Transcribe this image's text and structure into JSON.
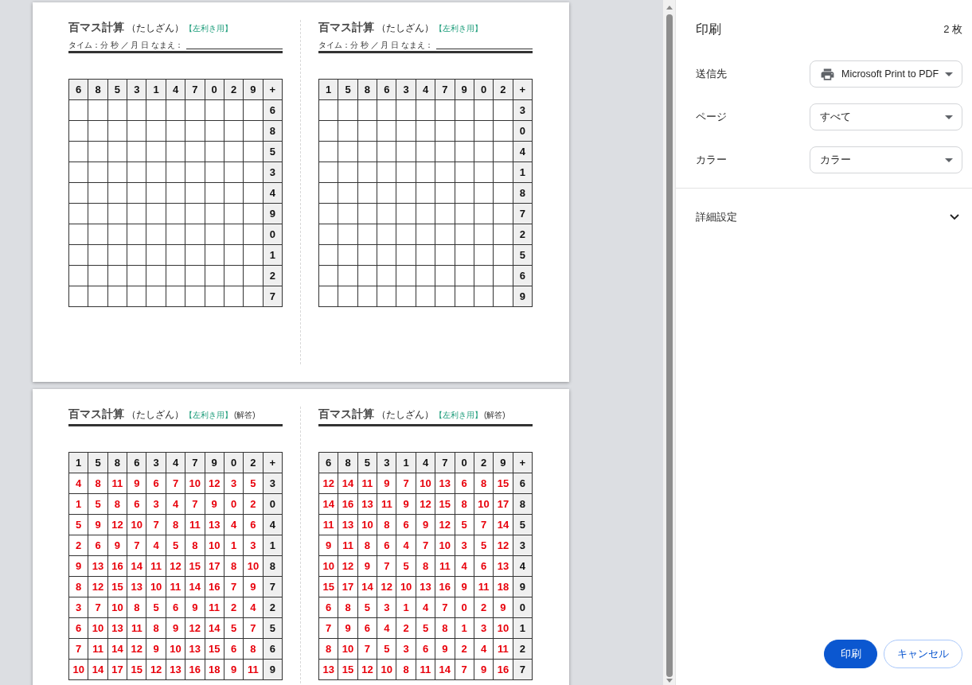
{
  "preview": {
    "pages": [
      {
        "sheets": [
          {
            "kind": "problem",
            "title": "百マス計算",
            "subtitle": "（たしざん）",
            "tag": "【左利き用】",
            "info_line": "タイム：分 秒 ／ 月 日 なまえ：",
            "grid": {
              "header": [
                "6",
                "8",
                "5",
                "3",
                "1",
                "4",
                "7",
                "0",
                "2",
                "9"
              ],
              "corner": "+",
              "rows": [
                {
                  "addend": "6"
                },
                {
                  "addend": "8"
                },
                {
                  "addend": "5"
                },
                {
                  "addend": "3"
                },
                {
                  "addend": "4"
                },
                {
                  "addend": "9"
                },
                {
                  "addend": "0"
                },
                {
                  "addend": "1"
                },
                {
                  "addend": "2"
                },
                {
                  "addend": "7"
                }
              ]
            }
          },
          {
            "kind": "problem",
            "title": "百マス計算",
            "subtitle": "（たしざん）",
            "tag": "【左利き用】",
            "info_line": "タイム：分 秒 ／ 月 日 なまえ：",
            "grid": {
              "header": [
                "1",
                "5",
                "8",
                "6",
                "3",
                "4",
                "7",
                "9",
                "0",
                "2"
              ],
              "corner": "+",
              "rows": [
                {
                  "addend": "3"
                },
                {
                  "addend": "0"
                },
                {
                  "addend": "4"
                },
                {
                  "addend": "1"
                },
                {
                  "addend": "8"
                },
                {
                  "addend": "7"
                },
                {
                  "addend": "2"
                },
                {
                  "addend": "5"
                },
                {
                  "addend": "6"
                },
                {
                  "addend": "9"
                }
              ]
            }
          }
        ]
      },
      {
        "sheets": [
          {
            "kind": "answer",
            "title": "百マス計算",
            "subtitle": "（たしざん）",
            "tag": "【左利き用】",
            "answer_label": "(解答)",
            "grid": {
              "header": [
                "1",
                "5",
                "8",
                "6",
                "3",
                "4",
                "7",
                "9",
                "0",
                "2"
              ],
              "corner": "+",
              "rows": [
                {
                  "cells": [
                    "4",
                    "8",
                    "11",
                    "9",
                    "6",
                    "7",
                    "10",
                    "12",
                    "3",
                    "5"
                  ],
                  "addend": "3"
                },
                {
                  "cells": [
                    "1",
                    "5",
                    "8",
                    "6",
                    "3",
                    "4",
                    "7",
                    "9",
                    "0",
                    "2"
                  ],
                  "addend": "0"
                },
                {
                  "cells": [
                    "5",
                    "9",
                    "12",
                    "10",
                    "7",
                    "8",
                    "11",
                    "13",
                    "4",
                    "6"
                  ],
                  "addend": "4"
                },
                {
                  "cells": [
                    "2",
                    "6",
                    "9",
                    "7",
                    "4",
                    "5",
                    "8",
                    "10",
                    "1",
                    "3"
                  ],
                  "addend": "1"
                },
                {
                  "cells": [
                    "9",
                    "13",
                    "16",
                    "14",
                    "11",
                    "12",
                    "15",
                    "17",
                    "8",
                    "10"
                  ],
                  "addend": "8"
                },
                {
                  "cells": [
                    "8",
                    "12",
                    "15",
                    "13",
                    "10",
                    "11",
                    "14",
                    "16",
                    "7",
                    "9"
                  ],
                  "addend": "7"
                },
                {
                  "cells": [
                    "3",
                    "7",
                    "10",
                    "8",
                    "5",
                    "6",
                    "9",
                    "11",
                    "2",
                    "4"
                  ],
                  "addend": "2"
                },
                {
                  "cells": [
                    "6",
                    "10",
                    "13",
                    "11",
                    "8",
                    "9",
                    "12",
                    "14",
                    "5",
                    "7"
                  ],
                  "addend": "5"
                },
                {
                  "cells": [
                    "7",
                    "11",
                    "14",
                    "12",
                    "9",
                    "10",
                    "13",
                    "15",
                    "6",
                    "8"
                  ],
                  "addend": "6"
                },
                {
                  "cells": [
                    "10",
                    "14",
                    "17",
                    "15",
                    "12",
                    "13",
                    "16",
                    "18",
                    "9",
                    "11"
                  ],
                  "addend": "9"
                }
              ]
            }
          },
          {
            "kind": "answer",
            "title": "百マス計算",
            "subtitle": "（たしざん）",
            "tag": "【左利き用】",
            "answer_label": "(解答)",
            "grid": {
              "header": [
                "6",
                "8",
                "5",
                "3",
                "1",
                "4",
                "7",
                "0",
                "2",
                "9"
              ],
              "corner": "+",
              "rows": [
                {
                  "cells": [
                    "12",
                    "14",
                    "11",
                    "9",
                    "7",
                    "10",
                    "13",
                    "6",
                    "8",
                    "15"
                  ],
                  "addend": "6"
                },
                {
                  "cells": [
                    "14",
                    "16",
                    "13",
                    "11",
                    "9",
                    "12",
                    "15",
                    "8",
                    "10",
                    "17"
                  ],
                  "addend": "8"
                },
                {
                  "cells": [
                    "11",
                    "13",
                    "10",
                    "8",
                    "6",
                    "9",
                    "12",
                    "5",
                    "7",
                    "14"
                  ],
                  "addend": "5"
                },
                {
                  "cells": [
                    "9",
                    "11",
                    "8",
                    "6",
                    "4",
                    "7",
                    "10",
                    "3",
                    "5",
                    "12"
                  ],
                  "addend": "3"
                },
                {
                  "cells": [
                    "10",
                    "12",
                    "9",
                    "7",
                    "5",
                    "8",
                    "11",
                    "4",
                    "6",
                    "13"
                  ],
                  "addend": "4"
                },
                {
                  "cells": [
                    "15",
                    "17",
                    "14",
                    "12",
                    "10",
                    "13",
                    "16",
                    "9",
                    "11",
                    "18"
                  ],
                  "addend": "9"
                },
                {
                  "cells": [
                    "6",
                    "8",
                    "5",
                    "3",
                    "1",
                    "4",
                    "7",
                    "0",
                    "2",
                    "9"
                  ],
                  "addend": "0"
                },
                {
                  "cells": [
                    "7",
                    "9",
                    "6",
                    "4",
                    "2",
                    "5",
                    "8",
                    "1",
                    "3",
                    "10"
                  ],
                  "addend": "1"
                },
                {
                  "cells": [
                    "8",
                    "10",
                    "7",
                    "5",
                    "3",
                    "6",
                    "9",
                    "2",
                    "4",
                    "11"
                  ],
                  "addend": "2"
                },
                {
                  "cells": [
                    "13",
                    "15",
                    "12",
                    "10",
                    "8",
                    "11",
                    "14",
                    "7",
                    "9",
                    "16"
                  ],
                  "addend": "7"
                }
              ]
            }
          }
        ]
      }
    ]
  },
  "panel": {
    "title": "印刷",
    "sheet_count": "2 枚",
    "settings": [
      {
        "label": "送信先",
        "value": "Microsoft Print to PDF",
        "kind": "printer"
      },
      {
        "label": "ページ",
        "value": "すべて",
        "kind": "select"
      },
      {
        "label": "カラー",
        "value": "カラー",
        "kind": "select"
      }
    ],
    "more_settings": {
      "label": "詳細設定",
      "expanded": false
    },
    "buttons": [
      {
        "label": "印刷",
        "kind": "primary"
      },
      {
        "label": "キャンセル",
        "kind": "secondary"
      }
    ]
  }
}
